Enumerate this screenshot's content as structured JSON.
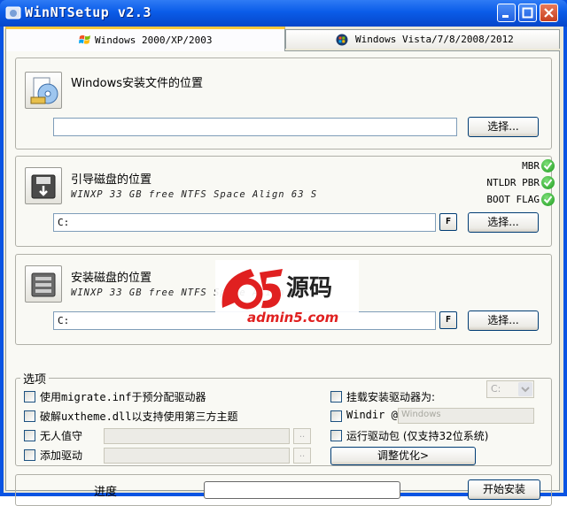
{
  "window": {
    "title": "WinNTSetup v2.3",
    "controls": {
      "minimize": "minimize-icon",
      "maximize": "maximize-icon",
      "close": "close-icon"
    }
  },
  "tabs": [
    {
      "label": "Windows 2000/XP/2003",
      "active": true
    },
    {
      "label": "Windows Vista/7/8/2008/2012",
      "active": false
    }
  ],
  "install_source": {
    "title": "Windows安装文件的位置",
    "path_value": "",
    "choose_label": "选择..."
  },
  "boot_drive": {
    "title": "引导磁盘的位置",
    "info": "WINXP 33 GB free NTFS Space Align 63 S",
    "path_value": "C:",
    "f_label": "F",
    "choose_label": "选择...",
    "status": [
      {
        "label": "MBR",
        "ok": true
      },
      {
        "label": "NTLDR PBR",
        "ok": true
      },
      {
        "label": "BOOT FLAG",
        "ok": true
      }
    ]
  },
  "install_drive": {
    "title": "安装磁盘的位置",
    "info": "WINXP 33 GB free NTFS Space Align 63 S",
    "path_value": "C:",
    "f_label": "F",
    "choose_label": "选择..."
  },
  "options": {
    "legend": "选项",
    "migrate": "使用migrate.inf于预分配驱动器",
    "uxtheme": "破解uxtheme.dll以支持使用第三方主题",
    "unattended": "无人值守",
    "add_drivers": "添加驱动",
    "dots": "..",
    "mount_drive": "挂载安装驱动器为:",
    "mount_value": "C:",
    "windir": "Windir @",
    "windir_value": "Windows",
    "run_driverpack": "运行驱动包 (仅支持32位系统)",
    "tweaks": "调整优化>"
  },
  "bottom": {
    "progress_label": "进度",
    "progress_percent": 0,
    "start_label": "开始安装"
  },
  "watermark": {
    "brand": "a5",
    "cn": "源码",
    "site": "admin5.com"
  },
  "colors": {
    "title_bar": "#0a54e3",
    "status_ok": "#1c9a1c",
    "watermark_red": "#e02020",
    "tab_highlight": "#ffc83c"
  }
}
